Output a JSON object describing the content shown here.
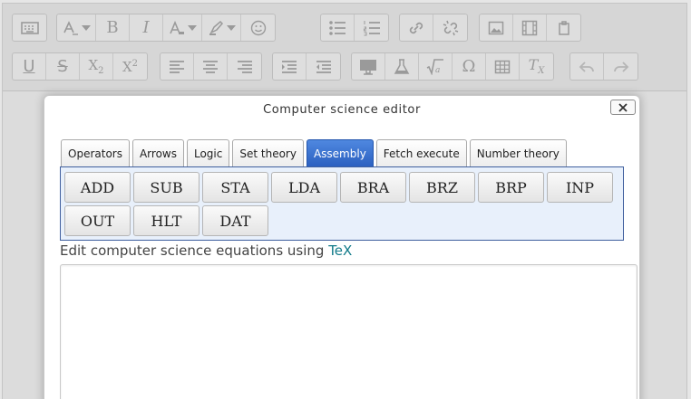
{
  "toolbar": {
    "row1": [
      {
        "id": "toolbar-toggle",
        "icon": "keyboard-icon"
      },
      {
        "id": "font-family",
        "icon": "font-family-icon"
      },
      {
        "id": "bold",
        "text": "B"
      },
      {
        "id": "italic",
        "text": "I"
      },
      {
        "id": "font-color",
        "icon": "font-color-icon"
      },
      {
        "id": "highlight",
        "icon": "highlight-icon"
      },
      {
        "id": "emoticons",
        "icon": "smiley-icon"
      },
      {
        "id": "bullet-list",
        "icon": "bullet-list-icon"
      },
      {
        "id": "numbered-list",
        "icon": "numbered-list-icon"
      },
      {
        "id": "link",
        "icon": "link-icon"
      },
      {
        "id": "unlink",
        "icon": "unlink-icon"
      },
      {
        "id": "image",
        "icon": "image-icon"
      },
      {
        "id": "media",
        "icon": "film-icon"
      },
      {
        "id": "paste",
        "icon": "paste-icon"
      }
    ],
    "row2_text": {
      "underline": "U",
      "strike": "S",
      "subscript_base": "X",
      "subscript": "2",
      "superscript_base": "X",
      "superscript": "2",
      "omega": "Ω",
      "clear_base": "T",
      "clear_sub": "X"
    }
  },
  "modal": {
    "title": "Computer science editor",
    "tabs": [
      {
        "label": "Operators",
        "active": false
      },
      {
        "label": "Arrows",
        "active": false
      },
      {
        "label": "Logic",
        "active": false
      },
      {
        "label": "Set theory",
        "active": false
      },
      {
        "label": "Assembly",
        "active": true
      },
      {
        "label": "Fetch execute",
        "active": false
      },
      {
        "label": "Number theory",
        "active": false
      }
    ],
    "buttons": [
      "ADD",
      "SUB",
      "STA",
      "LDA",
      "BRA",
      "BRZ",
      "BRP",
      "INP",
      "OUT",
      "HLT",
      "DAT"
    ],
    "help_text": "Edit computer science equations using ",
    "help_link": "TeX",
    "equation_value": ""
  },
  "colors": {
    "active_tab": "#2a5fbf",
    "panel_bg": "#e8f0fb",
    "link": "#137b8a"
  }
}
